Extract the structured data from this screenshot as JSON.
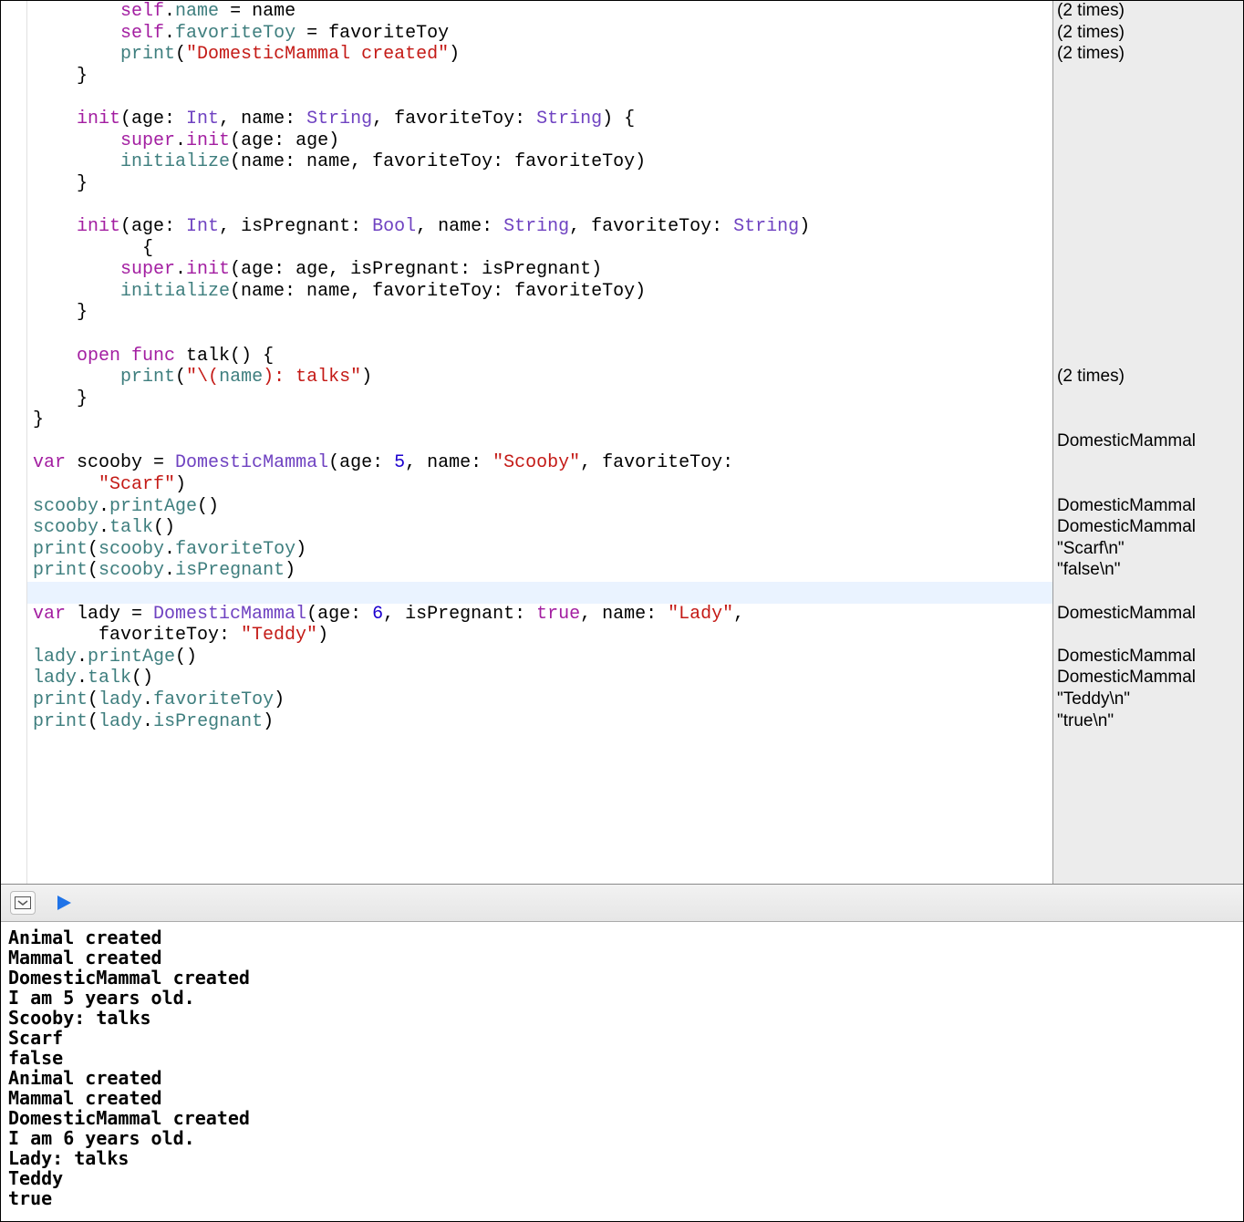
{
  "code_lines": [
    {
      "indent": "        ",
      "tokens": [
        {
          "c": "kw",
          "t": "self"
        },
        {
          "c": "plain",
          "t": "."
        },
        {
          "c": "prop",
          "t": "name"
        },
        {
          "c": "plain",
          "t": " = name"
        }
      ],
      "result": "(2 times)"
    },
    {
      "indent": "        ",
      "tokens": [
        {
          "c": "kw",
          "t": "self"
        },
        {
          "c": "plain",
          "t": "."
        },
        {
          "c": "prop",
          "t": "favoriteToy"
        },
        {
          "c": "plain",
          "t": " = favoriteToy"
        }
      ],
      "result": "(2 times)"
    },
    {
      "indent": "        ",
      "tokens": [
        {
          "c": "prop",
          "t": "print"
        },
        {
          "c": "plain",
          "t": "("
        },
        {
          "c": "str",
          "t": "\"DomesticMammal created\""
        },
        {
          "c": "plain",
          "t": ")"
        }
      ],
      "result": "(2 times)"
    },
    {
      "indent": "    ",
      "tokens": [
        {
          "c": "plain",
          "t": "}"
        }
      ],
      "result": ""
    },
    {
      "indent": "",
      "tokens": [],
      "result": ""
    },
    {
      "indent": "    ",
      "tokens": [
        {
          "c": "kw",
          "t": "init"
        },
        {
          "c": "plain",
          "t": "(age: "
        },
        {
          "c": "type",
          "t": "Int"
        },
        {
          "c": "plain",
          "t": ", name: "
        },
        {
          "c": "type",
          "t": "String"
        },
        {
          "c": "plain",
          "t": ", favoriteToy: "
        },
        {
          "c": "type",
          "t": "String"
        },
        {
          "c": "plain",
          "t": ") {"
        }
      ],
      "result": ""
    },
    {
      "indent": "        ",
      "tokens": [
        {
          "c": "kw",
          "t": "super"
        },
        {
          "c": "plain",
          "t": "."
        },
        {
          "c": "kw",
          "t": "init"
        },
        {
          "c": "plain",
          "t": "(age: age)"
        }
      ],
      "result": ""
    },
    {
      "indent": "        ",
      "tokens": [
        {
          "c": "prop",
          "t": "initialize"
        },
        {
          "c": "plain",
          "t": "(name: name, favoriteToy: favoriteToy)"
        }
      ],
      "result": ""
    },
    {
      "indent": "    ",
      "tokens": [
        {
          "c": "plain",
          "t": "}"
        }
      ],
      "result": ""
    },
    {
      "indent": "",
      "tokens": [],
      "result": ""
    },
    {
      "indent": "    ",
      "tokens": [
        {
          "c": "kw",
          "t": "init"
        },
        {
          "c": "plain",
          "t": "(age: "
        },
        {
          "c": "type",
          "t": "Int"
        },
        {
          "c": "plain",
          "t": ", isPregnant: "
        },
        {
          "c": "type",
          "t": "Bool"
        },
        {
          "c": "plain",
          "t": ", name: "
        },
        {
          "c": "type",
          "t": "String"
        },
        {
          "c": "plain",
          "t": ", favoriteToy: "
        },
        {
          "c": "type",
          "t": "String"
        },
        {
          "c": "plain",
          "t": ")"
        }
      ],
      "result": ""
    },
    {
      "indent": "          ",
      "tokens": [
        {
          "c": "plain",
          "t": "{"
        }
      ],
      "result": ""
    },
    {
      "indent": "        ",
      "tokens": [
        {
          "c": "kw",
          "t": "super"
        },
        {
          "c": "plain",
          "t": "."
        },
        {
          "c": "kw",
          "t": "init"
        },
        {
          "c": "plain",
          "t": "(age: age, isPregnant: isPregnant)"
        }
      ],
      "result": ""
    },
    {
      "indent": "        ",
      "tokens": [
        {
          "c": "prop",
          "t": "initialize"
        },
        {
          "c": "plain",
          "t": "(name: name, favoriteToy: favoriteToy)"
        }
      ],
      "result": ""
    },
    {
      "indent": "    ",
      "tokens": [
        {
          "c": "plain",
          "t": "}"
        }
      ],
      "result": ""
    },
    {
      "indent": "",
      "tokens": [],
      "result": ""
    },
    {
      "indent": "    ",
      "tokens": [
        {
          "c": "kw",
          "t": "open func"
        },
        {
          "c": "plain",
          "t": " talk() {"
        }
      ],
      "result": ""
    },
    {
      "indent": "        ",
      "tokens": [
        {
          "c": "prop",
          "t": "print"
        },
        {
          "c": "plain",
          "t": "("
        },
        {
          "c": "str",
          "t": "\"\\("
        },
        {
          "c": "prop",
          "t": "name"
        },
        {
          "c": "str",
          "t": "): talks\""
        },
        {
          "c": "plain",
          "t": ")"
        }
      ],
      "result": "(2 times)"
    },
    {
      "indent": "    ",
      "tokens": [
        {
          "c": "plain",
          "t": "}"
        }
      ],
      "result": ""
    },
    {
      "indent": "",
      "tokens": [
        {
          "c": "plain",
          "t": "}"
        }
      ],
      "result": ""
    },
    {
      "indent": "",
      "tokens": [],
      "result": "DomesticMammal"
    },
    {
      "indent": "",
      "tokens": [
        {
          "c": "kw",
          "t": "var"
        },
        {
          "c": "plain",
          "t": " scooby = "
        },
        {
          "c": "type",
          "t": "DomesticMammal"
        },
        {
          "c": "plain",
          "t": "(age: "
        },
        {
          "c": "num",
          "t": "5"
        },
        {
          "c": "plain",
          "t": ", name: "
        },
        {
          "c": "str",
          "t": "\"Scooby\""
        },
        {
          "c": "plain",
          "t": ", favoriteToy:"
        }
      ],
      "result": ""
    },
    {
      "indent": "      ",
      "tokens": [
        {
          "c": "str",
          "t": "\"Scarf\""
        },
        {
          "c": "plain",
          "t": ")"
        }
      ],
      "result": ""
    },
    {
      "indent": "",
      "tokens": [
        {
          "c": "prop",
          "t": "scooby"
        },
        {
          "c": "plain",
          "t": "."
        },
        {
          "c": "prop",
          "t": "printAge"
        },
        {
          "c": "plain",
          "t": "()"
        }
      ],
      "result": "DomesticMammal"
    },
    {
      "indent": "",
      "tokens": [
        {
          "c": "prop",
          "t": "scooby"
        },
        {
          "c": "plain",
          "t": "."
        },
        {
          "c": "prop",
          "t": "talk"
        },
        {
          "c": "plain",
          "t": "()"
        }
      ],
      "result": "DomesticMammal"
    },
    {
      "indent": "",
      "tokens": [
        {
          "c": "prop",
          "t": "print"
        },
        {
          "c": "plain",
          "t": "("
        },
        {
          "c": "prop",
          "t": "scooby"
        },
        {
          "c": "plain",
          "t": "."
        },
        {
          "c": "prop",
          "t": "favoriteToy"
        },
        {
          "c": "plain",
          "t": ")"
        }
      ],
      "result": "\"Scarf\\n\""
    },
    {
      "indent": "",
      "tokens": [
        {
          "c": "prop",
          "t": "print"
        },
        {
          "c": "plain",
          "t": "("
        },
        {
          "c": "prop",
          "t": "scooby"
        },
        {
          "c": "plain",
          "t": "."
        },
        {
          "c": "prop",
          "t": "isPregnant"
        },
        {
          "c": "plain",
          "t": ")"
        }
      ],
      "result": "\"false\\n\""
    },
    {
      "indent": "",
      "tokens": [],
      "result": "",
      "current": true
    },
    {
      "indent": "",
      "tokens": [
        {
          "c": "kw",
          "t": "var"
        },
        {
          "c": "plain",
          "t": " lady = "
        },
        {
          "c": "type",
          "t": "DomesticMammal"
        },
        {
          "c": "plain",
          "t": "(age: "
        },
        {
          "c": "num",
          "t": "6"
        },
        {
          "c": "plain",
          "t": ", isPregnant: "
        },
        {
          "c": "bool",
          "t": "true"
        },
        {
          "c": "plain",
          "t": ", name: "
        },
        {
          "c": "str",
          "t": "\"Lady\""
        },
        {
          "c": "plain",
          "t": ","
        }
      ],
      "result": "DomesticMammal"
    },
    {
      "indent": "      ",
      "tokens": [
        {
          "c": "plain",
          "t": "favoriteToy: "
        },
        {
          "c": "str",
          "t": "\"Teddy\""
        },
        {
          "c": "plain",
          "t": ")"
        }
      ],
      "result": ""
    },
    {
      "indent": "",
      "tokens": [
        {
          "c": "prop",
          "t": "lady"
        },
        {
          "c": "plain",
          "t": "."
        },
        {
          "c": "prop",
          "t": "printAge"
        },
        {
          "c": "plain",
          "t": "()"
        }
      ],
      "result": "DomesticMammal"
    },
    {
      "indent": "",
      "tokens": [
        {
          "c": "prop",
          "t": "lady"
        },
        {
          "c": "plain",
          "t": "."
        },
        {
          "c": "prop",
          "t": "talk"
        },
        {
          "c": "plain",
          "t": "()"
        }
      ],
      "result": "DomesticMammal"
    },
    {
      "indent": "",
      "tokens": [
        {
          "c": "prop",
          "t": "print"
        },
        {
          "c": "plain",
          "t": "("
        },
        {
          "c": "prop",
          "t": "lady"
        },
        {
          "c": "plain",
          "t": "."
        },
        {
          "c": "prop",
          "t": "favoriteToy"
        },
        {
          "c": "plain",
          "t": ")"
        }
      ],
      "result": "\"Teddy\\n\""
    },
    {
      "indent": "",
      "tokens": [
        {
          "c": "prop",
          "t": "print"
        },
        {
          "c": "plain",
          "t": "("
        },
        {
          "c": "prop",
          "t": "lady"
        },
        {
          "c": "plain",
          "t": "."
        },
        {
          "c": "prop",
          "t": "isPregnant"
        },
        {
          "c": "plain",
          "t": ")"
        }
      ],
      "result": "\"true\\n\""
    }
  ],
  "console_output": [
    "Animal created",
    "Mammal created",
    "DomesticMammal created",
    "I am 5 years old.",
    "Scooby: talks",
    "Scarf",
    "false",
    "Animal created",
    "Mammal created",
    "DomesticMammal created",
    "I am 6 years old.",
    "Lady: talks",
    "Teddy",
    "true"
  ]
}
